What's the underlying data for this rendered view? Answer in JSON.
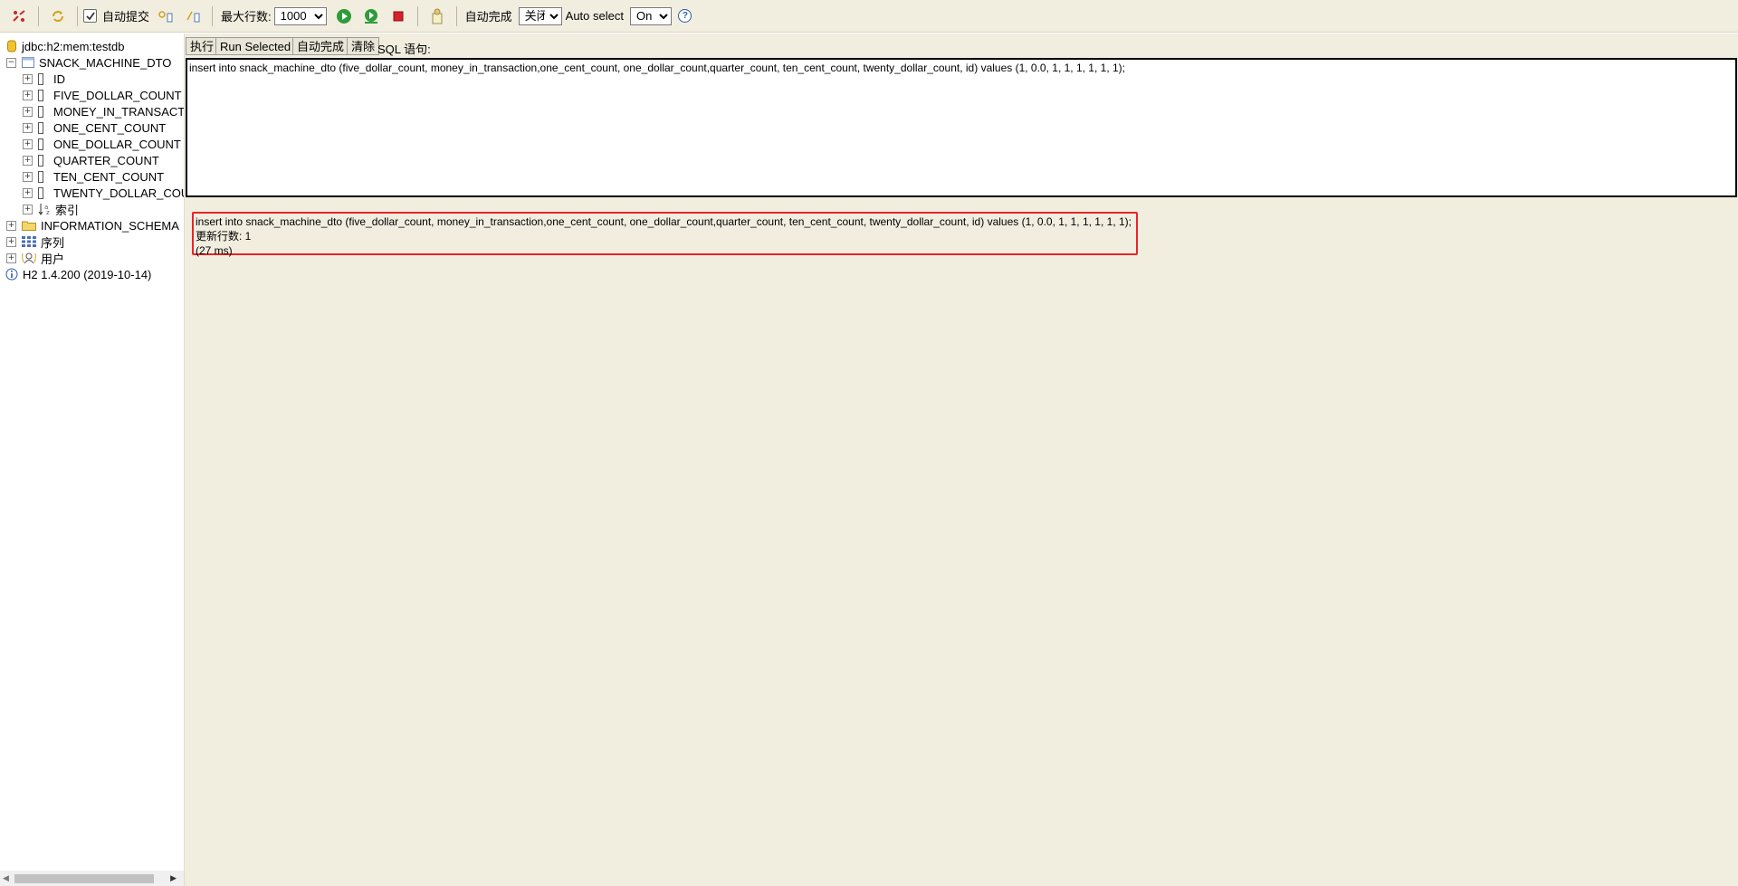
{
  "toolbar": {
    "autocommit_label": "自动提交",
    "max_rows_label": "最大行数:",
    "max_rows_value": "1000",
    "autocomplete_label": "自动完成",
    "autocomplete_value": "关闭",
    "auto_select_label": "Auto select",
    "auto_select_value": "On",
    "help_glyph": "?"
  },
  "tree": {
    "connection": "jdbc:h2:mem:testdb",
    "table": "SNACK_MACHINE_DTO",
    "columns": [
      "ID",
      "FIVE_DOLLAR_COUNT",
      "MONEY_IN_TRANSACTI",
      "ONE_CENT_COUNT",
      "ONE_DOLLAR_COUNT",
      "QUARTER_COUNT",
      "TEN_CENT_COUNT",
      "TWENTY_DOLLAR_COU"
    ],
    "indexes_label": "索引",
    "information_schema": "INFORMATION_SCHEMA",
    "sequences": "序列",
    "users": "用户",
    "version": "H2 1.4.200 (2019-10-14)"
  },
  "sql_panel": {
    "execute_label": "执行",
    "run_selected_label": "Run Selected",
    "autocomplete_label": "自动完成",
    "clear_label": "清除",
    "sql_statement_label": "SQL 语句:",
    "editor_text": "insert into snack_machine_dto (five_dollar_count, money_in_transaction,one_cent_count, one_dollar_count,quarter_count, ten_cent_count, twenty_dollar_count, id) values (1, 0.0, 1, 1, 1, 1, 1, 1);"
  },
  "result": {
    "statement": "insert into snack_machine_dto (five_dollar_count, money_in_transaction,one_cent_count, one_dollar_count,quarter_count, ten_cent_count, twenty_dollar_count, id) values (1, 0.0, 1, 1, 1, 1, 1, 1);",
    "update_count": "更新行数: 1",
    "duration": "(27 ms)"
  },
  "colors": {
    "panel_bg": "#f1eee0",
    "highlight_border": "#e8242a",
    "run_green": "#2e9b3a",
    "stop_red": "#d6222a"
  }
}
